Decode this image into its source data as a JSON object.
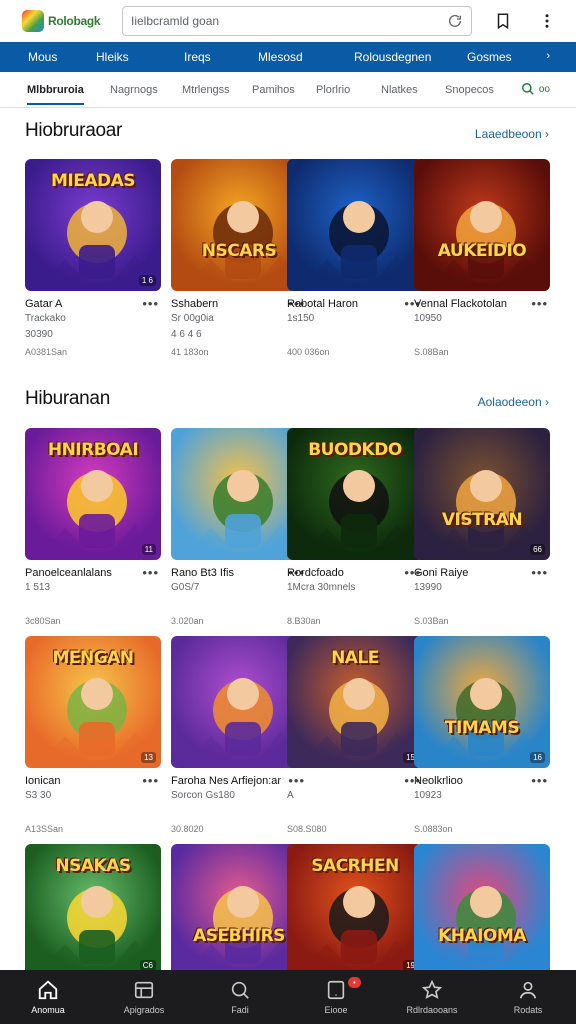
{
  "header": {
    "brand": "Rolobagk",
    "search_text": "Iielbcramld goan"
  },
  "categories": [
    "Mous",
    "Hleiks",
    "Ireqs",
    "Mlesosd",
    "Rolousdegnen",
    "Gosmes"
  ],
  "category_more": "›",
  "subtabs": [
    "Mlbbruroia",
    "Nagrnogs",
    "Mtrlengss",
    "Pamihos",
    "Plorlrio",
    "Nlatkes",
    "Snopecos"
  ],
  "subtab_search_label": "oo",
  "sections": [
    {
      "title": "Hiobruraoar",
      "link": "Laaedbeoon",
      "link_arrow": "›",
      "cards": [
        {
          "name": "Gatar A",
          "line2": "Trackako",
          "line2b": "30390",
          "line3": "A0381San",
          "badge": "1 6",
          "colors": [
            "#3b1c8c",
            "#7a3cd0",
            "#f0b33a"
          ],
          "art_title": "MIEADAS"
        },
        {
          "name": "Sshabern",
          "line2": "Sr 00g0ia",
          "line2b": "4 6 4 6",
          "line3": "41 183on",
          "badge": "",
          "colors": [
            "#b34b12",
            "#f5a623",
            "#6b2a0a"
          ],
          "art_title": "NSCARS"
        },
        {
          "name": "Rabotal Haron",
          "line2": "1s150",
          "line2b": "",
          "line3": "400 036on",
          "badge": "",
          "colors": [
            "#0f2a6e",
            "#1d63c7",
            "#0a1433"
          ],
          "art_title": ""
        },
        {
          "name": "Vennal Flackotolan",
          "line2": "10950",
          "line2b": "",
          "line3": "S.08Ban",
          "badge": "",
          "colors": [
            "#5a0e0a",
            "#c0391b",
            "#f2a33a"
          ],
          "art_title": "AUKEIDIO"
        }
      ]
    },
    {
      "title": "Hiburanan",
      "link": "Aolaodeeon",
      "link_arrow": "›",
      "cards": [
        {
          "name": "Panoelceanlalans",
          "line2": "1 513",
          "line2b": "",
          "line3": "3c80San",
          "badge": "11",
          "colors": [
            "#6a1b9a",
            "#d53cbe",
            "#ffca28"
          ],
          "art_title": "HNIRBOAI"
        },
        {
          "name": "Rano Bt3 Ifis",
          "line2": "G0S/7",
          "line2b": "",
          "line3": "3.020an",
          "badge": "",
          "colors": [
            "#4fa3d9",
            "#f6c04a",
            "#3a7d2c"
          ],
          "art_title": ""
        },
        {
          "name": "Rordcfoado",
          "line2": "1Mcra 30mnels",
          "line2b": "",
          "line3": "8.B30an",
          "badge": "",
          "colors": [
            "#0d2a0d",
            "#2f6a1e",
            "#111"
          ],
          "art_title": "BUODKDO"
        },
        {
          "name": "Goni Raiye",
          "line2": "13990",
          "line2b": "",
          "line3": "S.03Ban",
          "badge": "66",
          "colors": [
            "#2c2140",
            "#7c5230",
            "#f0a440"
          ],
          "art_title": "VISTRAN"
        }
      ]
    },
    {
      "title": "",
      "link": "",
      "link_arrow": "",
      "cards": [
        {
          "name": "Ionican",
          "line2": "S3 30",
          "line2b": "",
          "line3": "A13SSan",
          "badge": "13",
          "colors": [
            "#e86a2a",
            "#f6c54a",
            "#7cb342"
          ],
          "art_title": "MENGAN"
        },
        {
          "name": "Faroha Nes Arfiejon:an",
          "line2": "Sorcon Gs180",
          "line2b": "",
          "line3": "30.8020",
          "badge": "",
          "colors": [
            "#5b2a9b",
            "#b04ed0",
            "#f28e2b"
          ],
          "art_title": ""
        },
        {
          "name": "",
          "line2": "A",
          "line2b": "",
          "line3": "S08.S080",
          "badge": "15",
          "colors": [
            "#3e2a5a",
            "#c75d2b",
            "#f4b146"
          ],
          "art_title": "NALE"
        },
        {
          "name": "Neolkrlioo",
          "line2": "10923",
          "line2b": "",
          "line3": "S.0883on",
          "badge": "16",
          "colors": [
            "#2a85c8",
            "#f3a83a",
            "#3f6b2a"
          ],
          "art_title": "TIMAMS"
        }
      ]
    },
    {
      "title": "",
      "link": "",
      "link_arrow": "",
      "cards": [
        {
          "name": "",
          "line2": "",
          "line2b": "",
          "line3": "",
          "badge": "C6",
          "colors": [
            "#1b5e20",
            "#66bb6a",
            "#fdd835"
          ],
          "art_title": "NSAKAS"
        },
        {
          "name": "",
          "line2": "",
          "line2b": "",
          "line3": "",
          "badge": "",
          "colors": [
            "#5a2aa0",
            "#e55b8e",
            "#f6c24a"
          ],
          "art_title": "ASEBHIRS"
        },
        {
          "name": "",
          "line2": "",
          "line2b": "",
          "line3": "",
          "badge": "19",
          "colors": [
            "#8a1a12",
            "#e2521c",
            "#1a1a1a"
          ],
          "art_title": "SACRHEN"
        },
        {
          "name": "",
          "line2": "",
          "line2b": "",
          "line3": "",
          "badge": "",
          "colors": [
            "#2a86d2",
            "#e6477d",
            "#3d8b3a"
          ],
          "art_title": "KHAIOMA"
        }
      ]
    }
  ],
  "bottom_nav": [
    {
      "label": "Anomua",
      "icon": "home-icon"
    },
    {
      "label": "Apigrados",
      "icon": "apps-icon"
    },
    {
      "label": "Fadi",
      "icon": "search-icon"
    },
    {
      "label": "Eiooe",
      "icon": "device-icon",
      "badge": "•"
    },
    {
      "label": "Rdlrdaooans",
      "icon": "star-icon"
    },
    {
      "label": "Rodats",
      "icon": "profile-icon"
    }
  ]
}
